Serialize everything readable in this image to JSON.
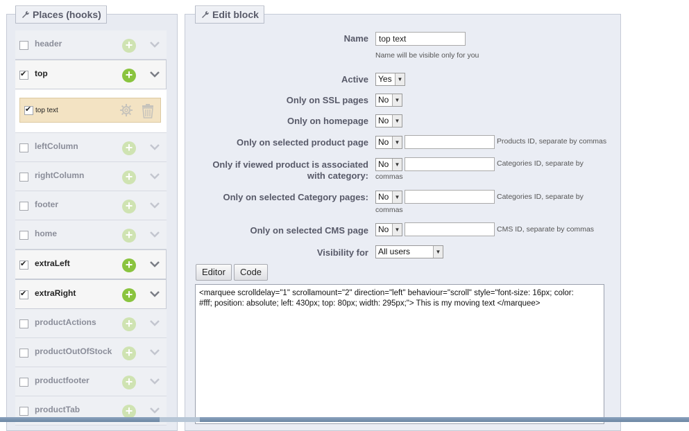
{
  "left": {
    "legend": "Places (hooks)",
    "hooks_before": [
      {
        "label": "header",
        "checked": false,
        "active": false
      },
      {
        "label": "top",
        "checked": true,
        "active": true
      }
    ],
    "module": {
      "label": "top text",
      "checked": true
    },
    "hooks_after": [
      {
        "label": "leftColumn",
        "checked": false,
        "active": false
      },
      {
        "label": "rightColumn",
        "checked": false,
        "active": false
      },
      {
        "label": "footer",
        "checked": false,
        "active": false
      },
      {
        "label": "home",
        "checked": false,
        "active": false
      },
      {
        "label": "extraLeft",
        "checked": true,
        "active": true
      },
      {
        "label": "extraRight",
        "checked": true,
        "active": true
      },
      {
        "label": "productActions",
        "checked": false,
        "active": false
      },
      {
        "label": "productOutOfStock",
        "checked": false,
        "active": false
      },
      {
        "label": "productfooter",
        "checked": false,
        "active": false
      },
      {
        "label": "productTab",
        "checked": false,
        "active": false
      }
    ]
  },
  "right": {
    "legend": "Edit block",
    "name": {
      "label": "Name",
      "value": "top text",
      "hint": "Name will be visible only for you"
    },
    "active": {
      "label": "Active",
      "value": "Yes"
    },
    "ssl": {
      "label": "Only on SSL pages",
      "value": "No"
    },
    "homepage": {
      "label": "Only on homepage",
      "value": "No"
    },
    "product": {
      "label": "Only on selected product page",
      "value": "No",
      "hint": "Products ID, separate by commas"
    },
    "assoc": {
      "label_line1": "Only if viewed product is associated",
      "label_line2": "with category:",
      "value": "No",
      "hint_line1": "Categories ID, separate by",
      "hint_line2": "commas"
    },
    "category": {
      "label": "Only on selected Category pages:",
      "value": "No",
      "hint_line1": "Categories ID, separate by",
      "hint_line2": "commas"
    },
    "cms": {
      "label": "Only on selected CMS page",
      "value": "No",
      "hint": "CMS ID, separate by commas"
    },
    "visibility": {
      "label": "Visibility for",
      "value": "All users"
    },
    "editor_button": "Editor",
    "code_button": "Code",
    "code_line1": "<marquee scrolldelay=\"1\" scrollamount=\"2\" direction=\"left\" behaviour=\"scroll\" style=\"font-size: 16px; color:",
    "code_line2": "#fff; position: absolute; left: 430px; top: 80px; width: 295px;\"> This is my moving text </marquee>"
  }
}
